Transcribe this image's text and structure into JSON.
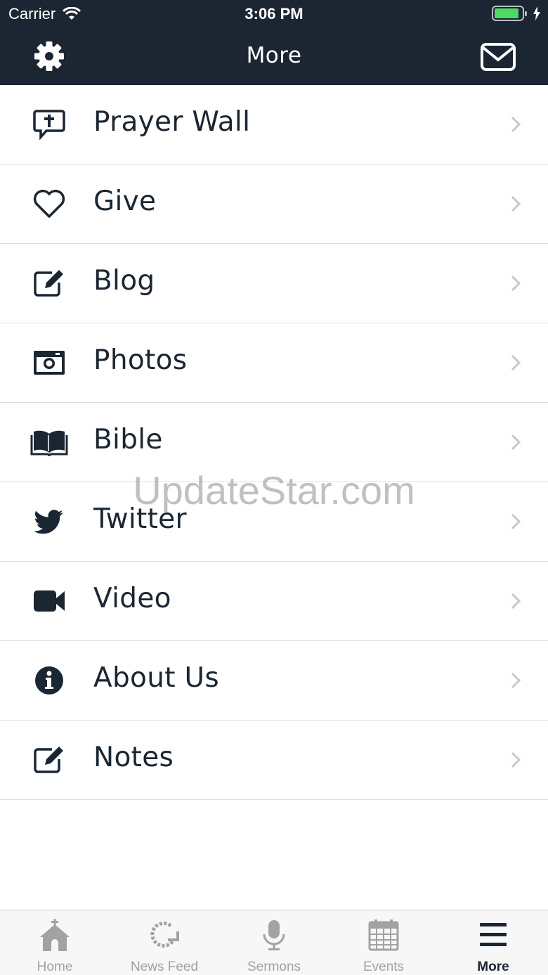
{
  "status_bar": {
    "carrier": "Carrier",
    "time": "3:06 PM"
  },
  "nav": {
    "title": "More",
    "left_icon": "gear-icon",
    "right_icon": "envelope-icon"
  },
  "menu": {
    "items": [
      {
        "label": "Prayer Wall",
        "icon": "prayer-bubble-icon"
      },
      {
        "label": "Give",
        "icon": "heart-icon"
      },
      {
        "label": "Blog",
        "icon": "edit-icon"
      },
      {
        "label": "Photos",
        "icon": "camera-icon"
      },
      {
        "label": "Bible",
        "icon": "book-icon"
      },
      {
        "label": "Twitter",
        "icon": "twitter-icon"
      },
      {
        "label": "Video",
        "icon": "video-camera-icon"
      },
      {
        "label": "About Us",
        "icon": "info-icon"
      },
      {
        "label": "Notes",
        "icon": "edit-icon"
      }
    ]
  },
  "watermark": "UpdateStar.com",
  "tabbar": {
    "tabs": [
      {
        "label": "Home",
        "icon": "church-icon",
        "active": false
      },
      {
        "label": "News Feed",
        "icon": "refresh-icon",
        "active": false
      },
      {
        "label": "Sermons",
        "icon": "microphone-icon",
        "active": false
      },
      {
        "label": "Events",
        "icon": "calendar-icon",
        "active": false
      },
      {
        "label": "More",
        "icon": "menu-icon",
        "active": true
      }
    ]
  },
  "colors": {
    "header": "#1c2633",
    "text": "#1b2633",
    "separator": "#dadde1",
    "tab_inactive": "#a2a2a2",
    "battery": "#4cd964"
  }
}
